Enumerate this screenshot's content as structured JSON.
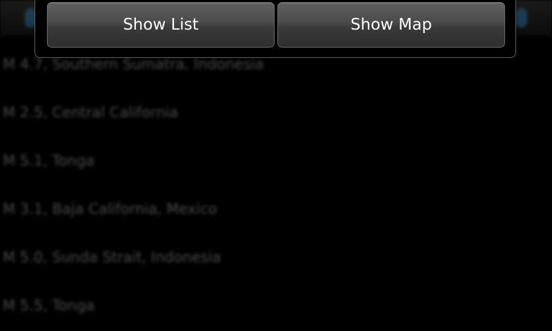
{
  "popup": {
    "buttons": [
      {
        "label": "Show List"
      },
      {
        "label": "Show Map"
      }
    ]
  },
  "background_list": {
    "items": [
      {
        "label": "M 4.7, Southern Sumatra, Indonesia"
      },
      {
        "label": "M 2.5, Central California"
      },
      {
        "label": "M 5.1, Tonga"
      },
      {
        "label": "M 3.1, Baja California, Mexico"
      },
      {
        "label": "M 5.0, Sunda Strait, Indonesia"
      },
      {
        "label": "M 5.5, Tonga"
      }
    ]
  }
}
